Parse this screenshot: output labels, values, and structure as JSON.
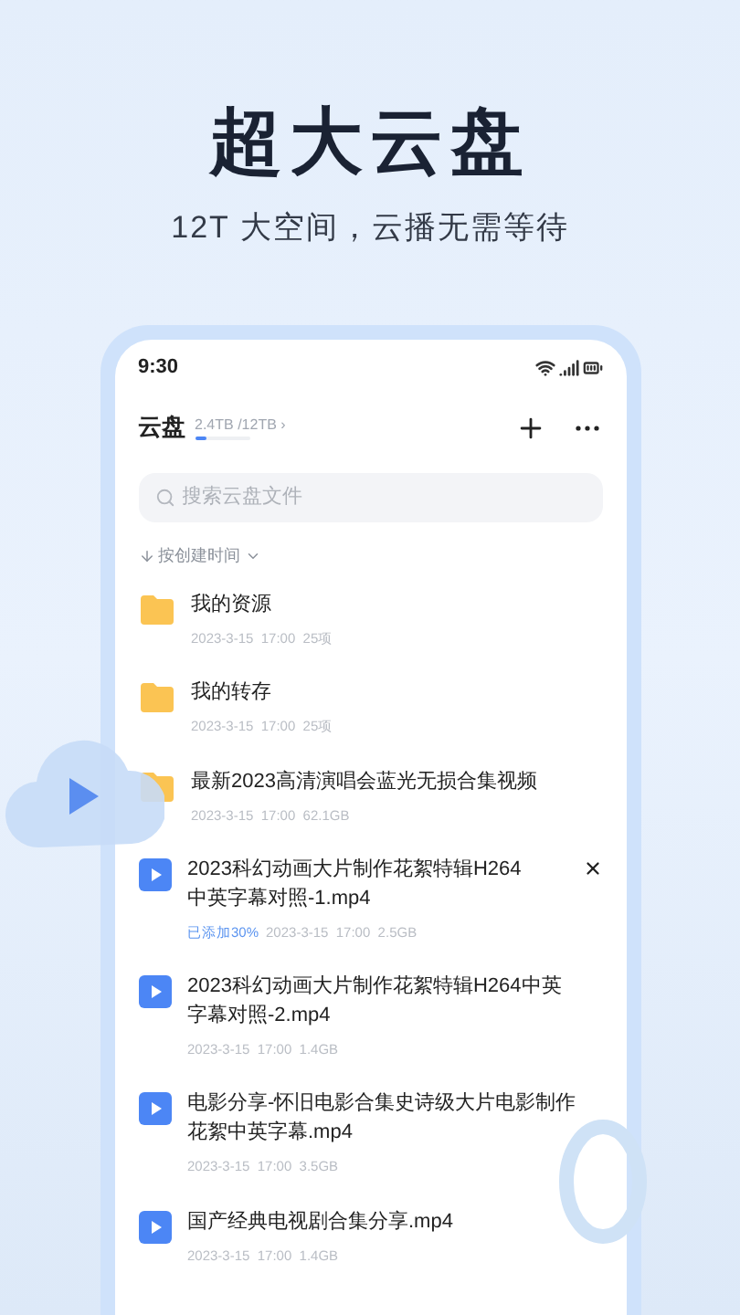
{
  "headline": "超大云盘",
  "subtitle": "12T 大空间，云播无需等待",
  "status_bar": {
    "time": "9:30"
  },
  "header": {
    "title": "云盘",
    "storage": "2.4TB /12TB",
    "level": 0.2,
    "chevron": "›"
  },
  "search": {
    "placeholder": "搜索云盘文件"
  },
  "sort": {
    "label": "按创建时间"
  },
  "files": [
    {
      "kind": "folder",
      "name": "我的资源",
      "meta": "2023-3-15  17:00  25项"
    },
    {
      "kind": "folder",
      "name": "我的转存",
      "meta": "2023-3-15  17:00  25项"
    },
    {
      "kind": "folder",
      "name": "最新2023高清演唱会蓝光无损合集视频",
      "meta": "2023-3-15  17:00  62.1GB"
    },
    {
      "kind": "video",
      "name": "2023科幻动画大片制作花絮特辑H264中英字幕对照-1.mp4",
      "progress": "已添加30%",
      "meta": "2023-3-15  17:00  2.5GB",
      "closable": true
    },
    {
      "kind": "video",
      "name": "2023科幻动画大片制作花絮特辑H264中英字幕对照-2.mp4",
      "meta": "2023-3-15  17:00  1.4GB"
    },
    {
      "kind": "video",
      "name": "电影分享-怀旧电影合集史诗级大片电影制作花絮中英字幕.mp4",
      "meta": "2023-3-15  17:00  3.5GB"
    },
    {
      "kind": "video",
      "name": "国产经典电视剧合集分享.mp4",
      "meta": "2023-3-15  17:00  1.4GB"
    }
  ]
}
